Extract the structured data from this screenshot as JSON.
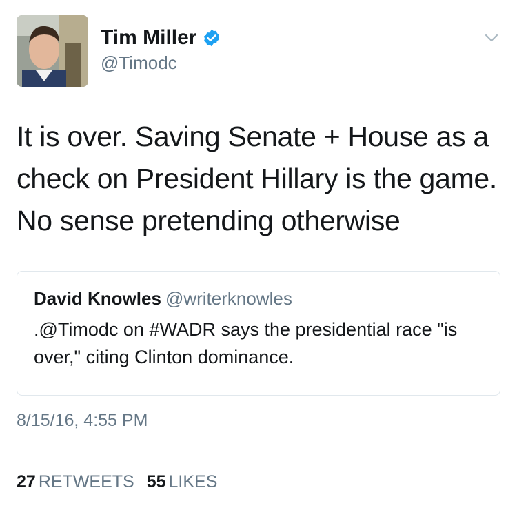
{
  "author": {
    "name": "Tim Miller",
    "handle": "@Timodc",
    "verified": true
  },
  "tweet": {
    "text": "It is over. Saving Senate + House as a check on President Hillary is the game. No sense pretending otherwise",
    "timestamp": "8/15/16, 4:55 PM"
  },
  "quote": {
    "name": "David Knowles",
    "handle": "@writerknowles",
    "text": ".@Timodc on #WADR says the presidential race \"is over,\" citing Clinton dominance."
  },
  "stats": {
    "retweets_count": "27",
    "retweets_label": "RETWEETS",
    "likes_count": "55",
    "likes_label": "LIKES"
  },
  "colors": {
    "verified_badge": "#1da1f2",
    "secondary_text": "#657786",
    "border": "#e1e8ed"
  },
  "icons": {
    "verified": "verified-badge-icon",
    "menu": "chevron-down-icon"
  }
}
